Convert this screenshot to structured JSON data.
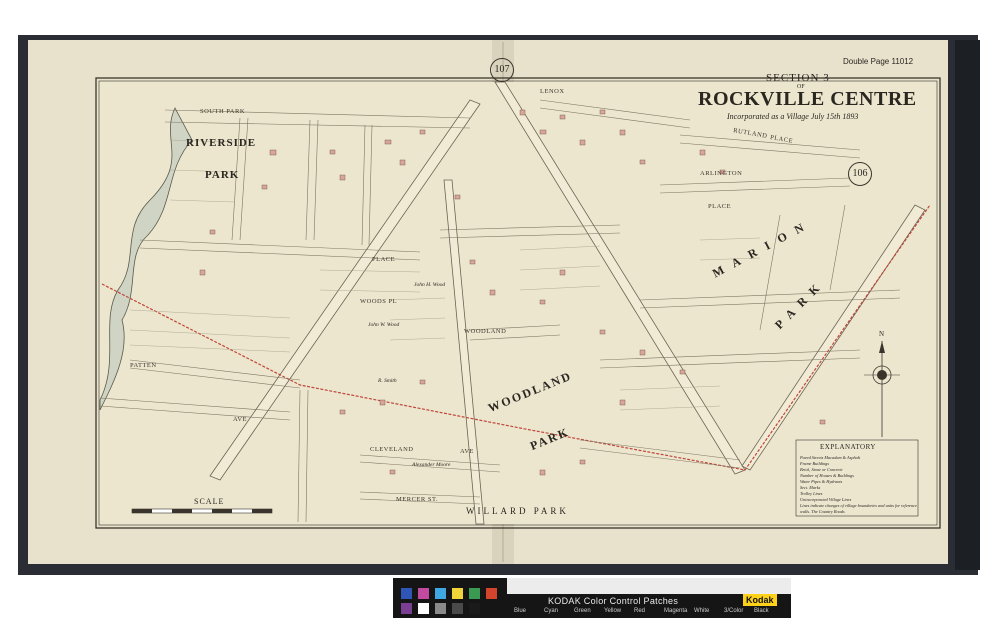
{
  "header": {
    "page_label": "Double Page 11012",
    "section": "SECTION 3",
    "of": "OF",
    "title": "ROCKVILLE CENTRE",
    "subtitle": "Incorporated as a Village July 15th 1893"
  },
  "plates": {
    "left": "107",
    "right": "106"
  },
  "areas": {
    "riverside": "RIVERSIDE",
    "riverside_park": "PARK",
    "marion": "MARION",
    "marion_park": "PARK",
    "woodland": "WOODLAND",
    "woodland_park": "PARK",
    "willard_park": "WILLARD PARK"
  },
  "streets": {
    "south_park": "SOUTH PARK",
    "place": "PLACE",
    "woods_pl": "WOODS PL",
    "woodland_ave": "WOODLAND",
    "cleveland": "CLEVELAND",
    "cleveland_ave": "AVE",
    "patten": "PATTEN",
    "ave": "AVE",
    "mercer_st": "MERCER ST.",
    "rutland": "RUTLAND",
    "rutland_place": "PLACE",
    "arlington": "ARLINGTON",
    "arlington_place": "PLACE",
    "lenox": "LENOX"
  },
  "owners": {
    "john_wood": "John H. Wood",
    "wood_2": "John W. Wood",
    "alexander_moore": "Alexander Moore",
    "r_smith": "R. Smith"
  },
  "legend": {
    "title": "EXPLANATORY",
    "items": [
      "Paved Streets Macadam & Asphalt",
      "Frame Buildings",
      "Brick, Stone or Concrete",
      "Number of Houses & Buildings",
      "Water Pipes & Hydrants",
      "Sect. Marks",
      "Trolley Lines",
      "Unincorporated Village Lines",
      "Lines indicate changes of village boundaries and units for reference",
      "walls. The Country Roads"
    ]
  },
  "scale": {
    "label": "SCALE"
  },
  "compass": {
    "label": "N"
  },
  "color_bar": {
    "title": "KODAK Color Control Patches",
    "brand": "Kodak",
    "names": [
      "Blue",
      "Cyan",
      "Green",
      "Yellow",
      "Red",
      "Magenta",
      "White",
      "3/Color",
      "Black"
    ],
    "patch_colors": [
      "#2f56b6",
      "#c24aa0",
      "#3fa8e2",
      "#f0d43a",
      "#3a9a52",
      "#d2452c",
      "#7a3e92",
      "#ffffff",
      "#8a8a8a",
      "#4a4a4a",
      "#1a1a1a"
    ]
  }
}
